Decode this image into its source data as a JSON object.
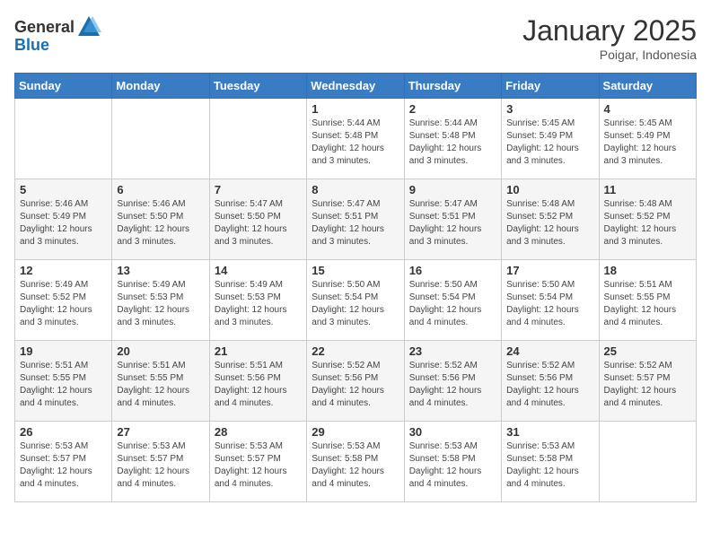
{
  "header": {
    "logo_general": "General",
    "logo_blue": "Blue",
    "month_title": "January 2025",
    "location": "Poigar, Indonesia"
  },
  "weekdays": [
    "Sunday",
    "Monday",
    "Tuesday",
    "Wednesday",
    "Thursday",
    "Friday",
    "Saturday"
  ],
  "weeks": [
    [
      {
        "day": "",
        "info": ""
      },
      {
        "day": "",
        "info": ""
      },
      {
        "day": "",
        "info": ""
      },
      {
        "day": "1",
        "info": "Sunrise: 5:44 AM\nSunset: 5:48 PM\nDaylight: 12 hours\nand 3 minutes."
      },
      {
        "day": "2",
        "info": "Sunrise: 5:44 AM\nSunset: 5:48 PM\nDaylight: 12 hours\nand 3 minutes."
      },
      {
        "day": "3",
        "info": "Sunrise: 5:45 AM\nSunset: 5:49 PM\nDaylight: 12 hours\nand 3 minutes."
      },
      {
        "day": "4",
        "info": "Sunrise: 5:45 AM\nSunset: 5:49 PM\nDaylight: 12 hours\nand 3 minutes."
      }
    ],
    [
      {
        "day": "5",
        "info": "Sunrise: 5:46 AM\nSunset: 5:49 PM\nDaylight: 12 hours\nand 3 minutes."
      },
      {
        "day": "6",
        "info": "Sunrise: 5:46 AM\nSunset: 5:50 PM\nDaylight: 12 hours\nand 3 minutes."
      },
      {
        "day": "7",
        "info": "Sunrise: 5:47 AM\nSunset: 5:50 PM\nDaylight: 12 hours\nand 3 minutes."
      },
      {
        "day": "8",
        "info": "Sunrise: 5:47 AM\nSunset: 5:51 PM\nDaylight: 12 hours\nand 3 minutes."
      },
      {
        "day": "9",
        "info": "Sunrise: 5:47 AM\nSunset: 5:51 PM\nDaylight: 12 hours\nand 3 minutes."
      },
      {
        "day": "10",
        "info": "Sunrise: 5:48 AM\nSunset: 5:52 PM\nDaylight: 12 hours\nand 3 minutes."
      },
      {
        "day": "11",
        "info": "Sunrise: 5:48 AM\nSunset: 5:52 PM\nDaylight: 12 hours\nand 3 minutes."
      }
    ],
    [
      {
        "day": "12",
        "info": "Sunrise: 5:49 AM\nSunset: 5:52 PM\nDaylight: 12 hours\nand 3 minutes."
      },
      {
        "day": "13",
        "info": "Sunrise: 5:49 AM\nSunset: 5:53 PM\nDaylight: 12 hours\nand 3 minutes."
      },
      {
        "day": "14",
        "info": "Sunrise: 5:49 AM\nSunset: 5:53 PM\nDaylight: 12 hours\nand 3 minutes."
      },
      {
        "day": "15",
        "info": "Sunrise: 5:50 AM\nSunset: 5:54 PM\nDaylight: 12 hours\nand 3 minutes."
      },
      {
        "day": "16",
        "info": "Sunrise: 5:50 AM\nSunset: 5:54 PM\nDaylight: 12 hours\nand 4 minutes."
      },
      {
        "day": "17",
        "info": "Sunrise: 5:50 AM\nSunset: 5:54 PM\nDaylight: 12 hours\nand 4 minutes."
      },
      {
        "day": "18",
        "info": "Sunrise: 5:51 AM\nSunset: 5:55 PM\nDaylight: 12 hours\nand 4 minutes."
      }
    ],
    [
      {
        "day": "19",
        "info": "Sunrise: 5:51 AM\nSunset: 5:55 PM\nDaylight: 12 hours\nand 4 minutes."
      },
      {
        "day": "20",
        "info": "Sunrise: 5:51 AM\nSunset: 5:55 PM\nDaylight: 12 hours\nand 4 minutes."
      },
      {
        "day": "21",
        "info": "Sunrise: 5:51 AM\nSunset: 5:56 PM\nDaylight: 12 hours\nand 4 minutes."
      },
      {
        "day": "22",
        "info": "Sunrise: 5:52 AM\nSunset: 5:56 PM\nDaylight: 12 hours\nand 4 minutes."
      },
      {
        "day": "23",
        "info": "Sunrise: 5:52 AM\nSunset: 5:56 PM\nDaylight: 12 hours\nand 4 minutes."
      },
      {
        "day": "24",
        "info": "Sunrise: 5:52 AM\nSunset: 5:56 PM\nDaylight: 12 hours\nand 4 minutes."
      },
      {
        "day": "25",
        "info": "Sunrise: 5:52 AM\nSunset: 5:57 PM\nDaylight: 12 hours\nand 4 minutes."
      }
    ],
    [
      {
        "day": "26",
        "info": "Sunrise: 5:53 AM\nSunset: 5:57 PM\nDaylight: 12 hours\nand 4 minutes."
      },
      {
        "day": "27",
        "info": "Sunrise: 5:53 AM\nSunset: 5:57 PM\nDaylight: 12 hours\nand 4 minutes."
      },
      {
        "day": "28",
        "info": "Sunrise: 5:53 AM\nSunset: 5:57 PM\nDaylight: 12 hours\nand 4 minutes."
      },
      {
        "day": "29",
        "info": "Sunrise: 5:53 AM\nSunset: 5:58 PM\nDaylight: 12 hours\nand 4 minutes."
      },
      {
        "day": "30",
        "info": "Sunrise: 5:53 AM\nSunset: 5:58 PM\nDaylight: 12 hours\nand 4 minutes."
      },
      {
        "day": "31",
        "info": "Sunrise: 5:53 AM\nSunset: 5:58 PM\nDaylight: 12 hours\nand 4 minutes."
      },
      {
        "day": "",
        "info": ""
      }
    ]
  ]
}
